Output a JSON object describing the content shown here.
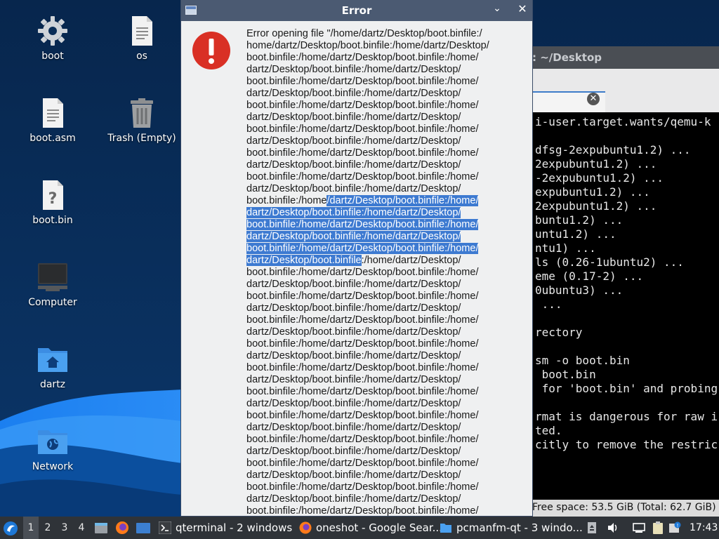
{
  "desktop": {
    "icons": [
      {
        "label": "boot",
        "icon": "gear-icon"
      },
      {
        "label": "os",
        "icon": "text-file-icon"
      },
      {
        "label": "boot.asm",
        "icon": "text-file-icon"
      },
      {
        "label": "Trash (Empty)",
        "icon": "trash-icon"
      },
      {
        "label": "boot.bin",
        "icon": "unknown-file-icon"
      },
      {
        "label": "Computer",
        "icon": "computer-icon"
      },
      {
        "label": "dartz",
        "icon": "home-folder-icon"
      },
      {
        "label": "Network",
        "icon": "network-folder-icon"
      }
    ]
  },
  "terminal": {
    "title": ": ~/Desktop",
    "lines": [
      "i-user.target.wants/qemu-k",
      "",
      "dfsg-2expubuntu1.2) ...",
      "2expubuntu1.2) ...",
      "-2expubuntu1.2) ...",
      "expubuntu1.2) ...",
      "2expubuntu1.2) ...",
      "buntu1.2) ...",
      "untu1.2) ...",
      "ntu1) ...",
      "ls (0.26-1ubuntu2) ...",
      "eme (0.17-2) ...",
      "0ubuntu3) ...",
      " ...",
      "",
      "rectory",
      "",
      "sm -o boot.bin",
      " boot.bin",
      " for 'boot.bin' and probing",
      "",
      "rmat is dangerous for raw i",
      "ted.",
      "citly to remove the restric"
    ],
    "status": "Free space: 53.5 GiB (Total: 62.7 GiB)"
  },
  "dialog": {
    "title": "Error",
    "minimize": "⌄",
    "close": "✕",
    "msg": {
      "l00": "Error opening file \"/home/dartz/Desktop/boot.binfile:/",
      "l01": "home/dartz/Desktop/boot.binfile:/home/dartz/Desktop/",
      "l02": "boot.binfile:/home/dartz/Desktop/boot.binfile:/home/",
      "l03": "dartz/Desktop/boot.binfile:/home/dartz/Desktop/",
      "l04": "boot.binfile:/home/dartz/Desktop/boot.binfile:/home/",
      "l05": "dartz/Desktop/boot.binfile:/home/dartz/Desktop/",
      "l06": "boot.binfile:/home/dartz/Desktop/boot.binfile:/home/",
      "l07": "dartz/Desktop/boot.binfile:/home/dartz/Desktop/",
      "l08": "boot.binfile:/home/dartz/Desktop/boot.binfile:/home/",
      "l09": "dartz/Desktop/boot.binfile:/home/dartz/Desktop/",
      "l10": "boot.binfile:/home/dartz/Desktop/boot.binfile:/home/",
      "l11": "dartz/Desktop/boot.binfile:/home/dartz/Desktop/",
      "l12": "boot.binfile:/home/dartz/Desktop/boot.binfile:/home/",
      "l13": "dartz/Desktop/boot.binfile:/home/dartz/Desktop/",
      "l14a": "boot.binfile:/home",
      "l14b": "/dartz/Desktop/boot.binfile:/home/",
      "l15": "dartz/Desktop/boot.binfile:/home/dartz/Desktop/",
      "l16": "boot.binfile:/home/dartz/Desktop/boot.binfile:/home/",
      "l17": "dartz/Desktop/boot.binfile:/home/dartz/Desktop/",
      "l18": "boot.binfile:/home/dartz/Desktop/boot.binfile:/home/",
      "l19a": "dartz/Desktop/boot.binfile",
      "l19b": ":/home/dartz/Desktop/",
      "l20": "boot.binfile:/home/dartz/Desktop/boot.binfile:/home/",
      "l21": "dartz/Desktop/boot.binfile:/home/dartz/Desktop/",
      "l22": "boot.binfile:/home/dartz/Desktop/boot.binfile:/home/",
      "l23": "dartz/Desktop/boot.binfile:/home/dartz/Desktop/",
      "l24": "boot.binfile:/home/dartz/Desktop/boot.binfile:/home/",
      "l25": "dartz/Desktop/boot.binfile:/home/dartz/Desktop/",
      "l26": "boot.binfile:/home/dartz/Desktop/boot.binfile:/home/",
      "l27": "dartz/Desktop/boot.binfile:/home/dartz/Desktop/",
      "l28": "boot.binfile:/home/dartz/Desktop/boot.binfile:/home/",
      "l29": "dartz/Desktop/boot.binfile:/home/dartz/Desktop/",
      "l30": "boot.binfile:/home/dartz/Desktop/boot.binfile:/home/",
      "l31": "dartz/Desktop/boot.binfile:/home/dartz/Desktop/",
      "l32": "boot.binfile:/home/dartz/Desktop/boot.binfile:/home/",
      "l33": "dartz/Desktop/boot.binfile:/home/dartz/Desktop/",
      "l34": "boot.binfile:/home/dartz/Desktop/boot.binfile:/home/",
      "l35": "dartz/Desktop/boot.binfile:/home/dartz/Desktop/",
      "l36": "boot.binfile:/home/dartz/Desktop/boot.binfile:/home/",
      "l37": "dartz/Desktop/boot.binfile:/home/dartz/Desktop/",
      "l38": "boot.binfile:/home/dartz/Desktop/boot.binfile:/home/",
      "l39": "dartz/Desktop/boot.binfile:/home/dartz/Desktop/",
      "l40": "boot.binfile:/home/dartz/Desktop/boot.binfile:/home/"
    }
  },
  "taskbar": {
    "workspaces": [
      "1",
      "2",
      "3",
      "4"
    ],
    "tasks": [
      {
        "label": "qterminal - 2 windows"
      },
      {
        "label": "oneshot - Google Sear..."
      },
      {
        "label": "pcmanfm-qt - 3 windo..."
      }
    ],
    "clock": "17:43"
  },
  "colors": {
    "accent": "#3d7ad1",
    "error": "#d93025",
    "titlebar": "#4b5a72",
    "taskbar": "#2f3338"
  }
}
